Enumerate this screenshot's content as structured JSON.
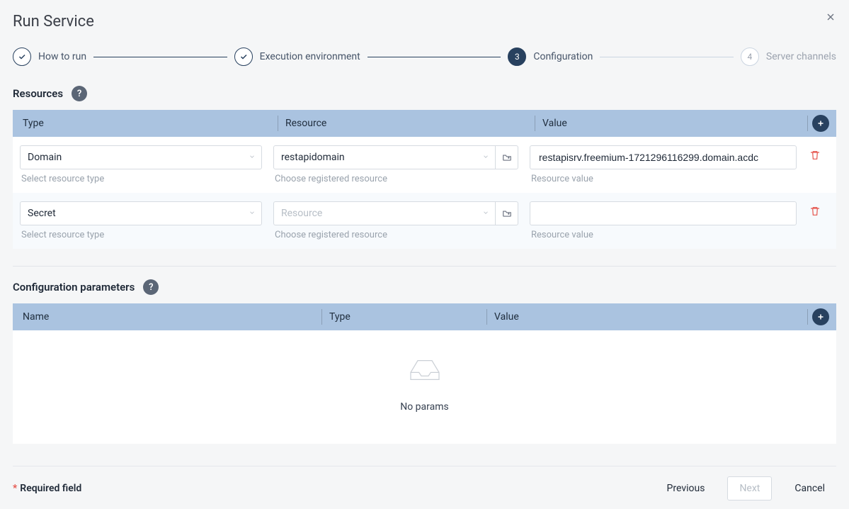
{
  "title": "Run Service",
  "steps": [
    {
      "label": "How to run"
    },
    {
      "label": "Execution environment"
    },
    {
      "number": "3",
      "label": "Configuration"
    },
    {
      "number": "4",
      "label": "Server channels"
    }
  ],
  "resources": {
    "title": "Resources",
    "columns": {
      "type": "Type",
      "resource": "Resource",
      "value": "Value"
    },
    "hints": {
      "type": "Select resource type",
      "resource": "Choose registered resource",
      "value": "Resource value"
    },
    "resource_placeholder": "Resource",
    "rows": [
      {
        "type": "Domain",
        "resource": "restapidomain",
        "value": "restapisrv.freemium-1721296116299.domain.acdc"
      },
      {
        "type": "Secret",
        "resource": "",
        "value": ""
      }
    ]
  },
  "params": {
    "title": "Configuration parameters",
    "columns": {
      "name": "Name",
      "type": "Type",
      "value": "Value"
    },
    "empty": "No params"
  },
  "footer": {
    "required": "Required field",
    "previous": "Previous",
    "next": "Next",
    "cancel": "Cancel"
  }
}
